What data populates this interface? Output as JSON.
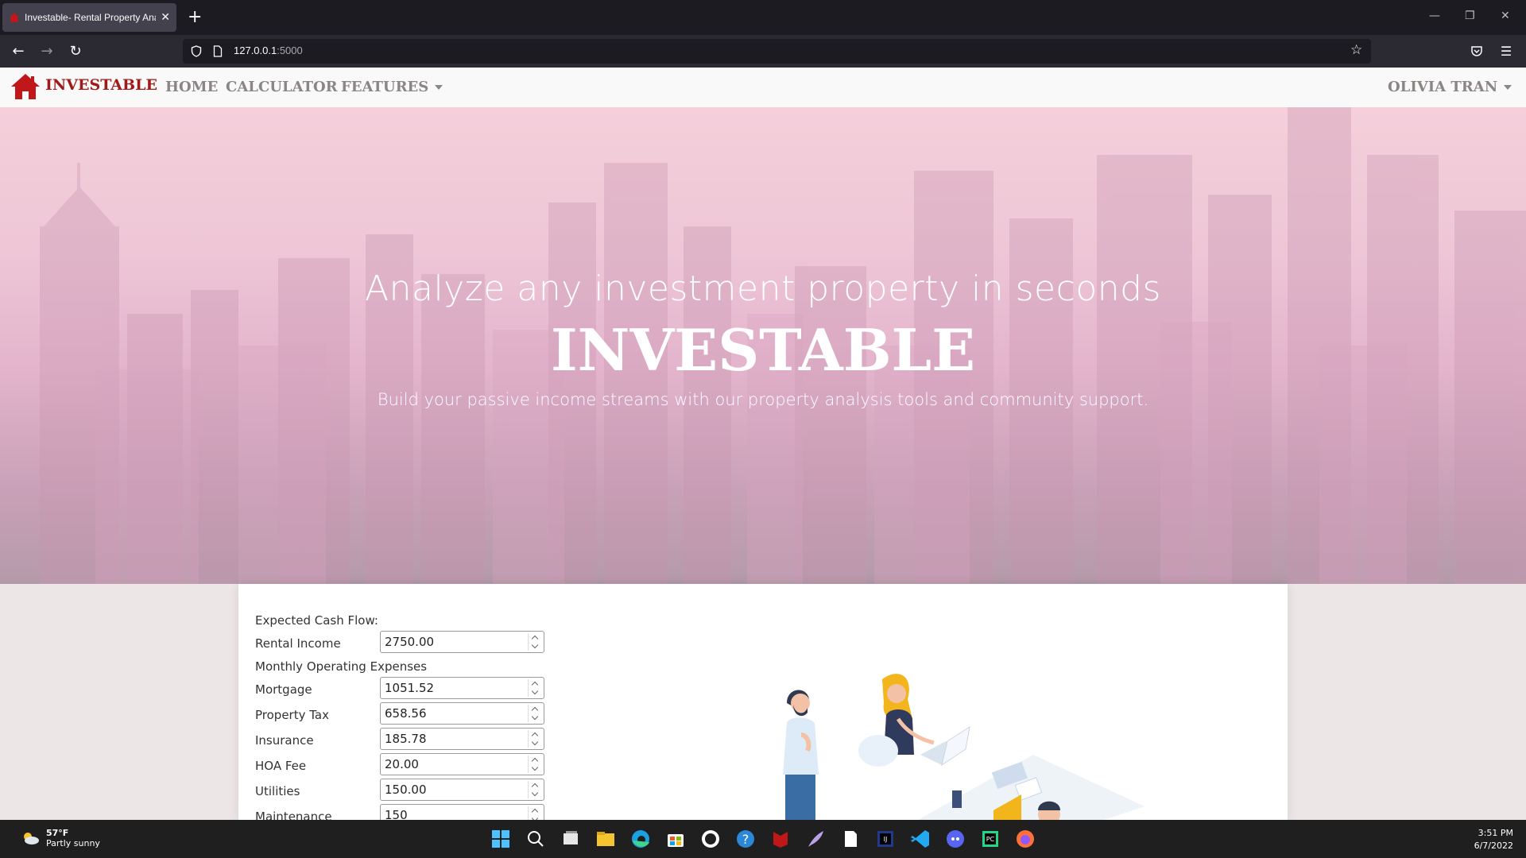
{
  "browser": {
    "tab_title": "Investable- Rental Property Analysis",
    "url_host": "127.0.0.1",
    "url_port": ":5000"
  },
  "header": {
    "logo_text": "INVESTABLE",
    "nav": [
      "HOME",
      "CALCULATOR",
      "FEATURES"
    ],
    "user_name": "OLIVIA TRAN"
  },
  "hero": {
    "subtitle": "Analyze any investment property in seconds",
    "title": "INVESTABLE",
    "description": "Build your passive income streams with our property analysis tools and community support."
  },
  "calculator": {
    "section_cash_flow": "Expected Cash Flow:",
    "rental_income_label": "Rental Income",
    "rental_income_value": "2750.00",
    "section_expenses": "Monthly Operating Expenses",
    "fields": [
      {
        "label": "Mortgage",
        "value": "1051.52"
      },
      {
        "label": "Property Tax",
        "value": "658.56"
      },
      {
        "label": "Insurance",
        "value": "185.78"
      },
      {
        "label": "HOA Fee",
        "value": "20.00"
      },
      {
        "label": "Utilities",
        "value": "150.00"
      },
      {
        "label": "Maintenance",
        "value": "150"
      }
    ]
  },
  "taskbar": {
    "weather_temp": "57°F",
    "weather_desc": "Partly sunny",
    "time": "3:51 PM",
    "date": "6/7/2022"
  },
  "colors": {
    "brand": "#a11a1a",
    "nav_text": "#8b8585",
    "hero_pink": "#eec6d6"
  }
}
